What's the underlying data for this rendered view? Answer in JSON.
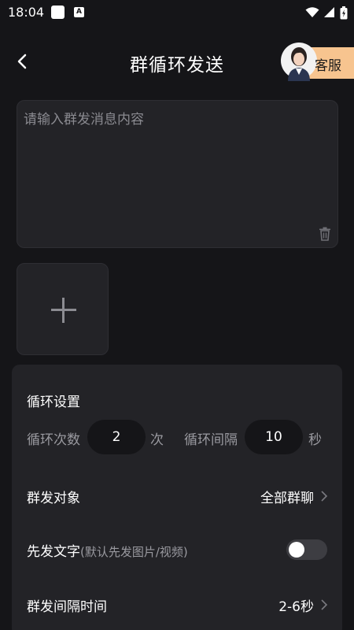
{
  "status_bar": {
    "time": "18:04"
  },
  "header": {
    "title": "群循环发送",
    "service_label": "客服"
  },
  "message": {
    "placeholder": "请输入群发消息内容",
    "value": ""
  },
  "settings": {
    "section_title": "循环设置",
    "loop_count_label": "循环次数",
    "loop_count_value": "2",
    "loop_count_unit": "次",
    "loop_interval_label": "循环间隔",
    "loop_interval_value": "10",
    "loop_interval_unit": "秒",
    "target_label": "群发对象",
    "target_value": "全部群聊",
    "text_first_label": "先发文字",
    "text_first_hint": "(默认先发图片/视频)",
    "text_first_enabled": false,
    "send_interval_label": "群发间隔时间",
    "send_interval_value": "2-6秒"
  },
  "colors": {
    "background": "#151518",
    "card": "#232327",
    "service_badge": "#f7c48f",
    "muted_text": "#9a9aa0",
    "toggle_off": "#3d3d42"
  },
  "icons": {
    "back": "chevron-left-icon",
    "trash": "trash-icon",
    "add": "plus-icon",
    "chevron": "chevron-right-icon"
  }
}
